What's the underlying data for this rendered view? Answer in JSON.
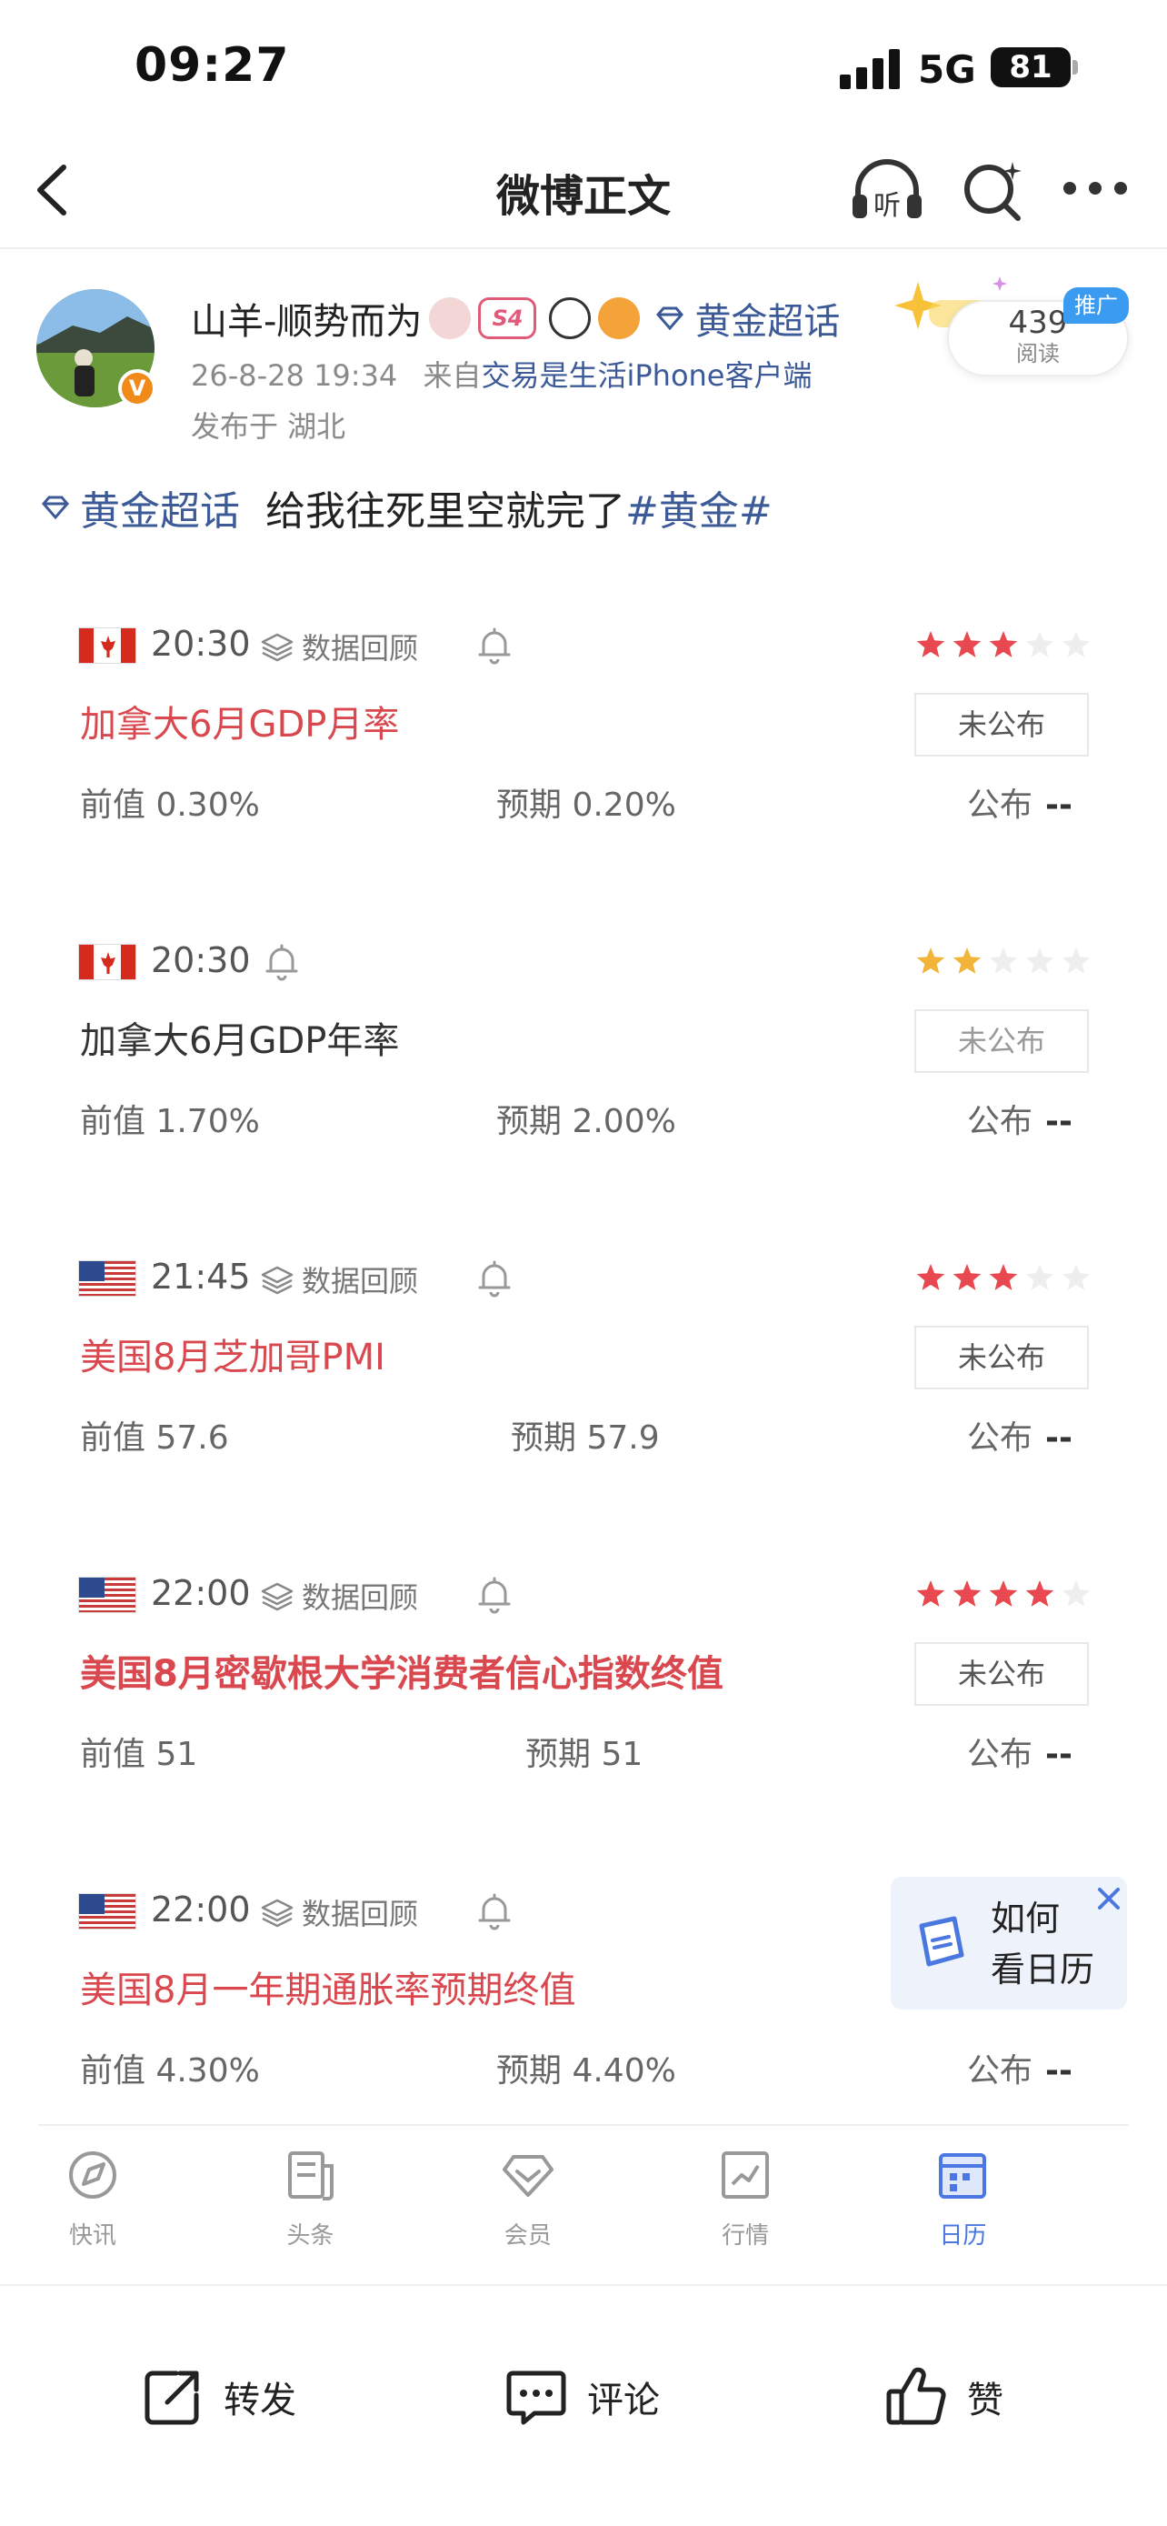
{
  "status_bar": {
    "time": "09:27",
    "network": "5G",
    "battery": "81"
  },
  "nav": {
    "title": "微博正文",
    "listen_label": "听"
  },
  "post": {
    "username": "山羊-顺势而为",
    "badge_s": "S4",
    "verified_mark": "V",
    "topic_tag": "黄金超话",
    "timestamp": "26-8-28 19:34",
    "source_prefix": "来自",
    "source": "交易是生活iPhone客户端",
    "location": "发布于 湖北",
    "reads_count": "439",
    "reads_label": "阅读",
    "promo_label": "推广",
    "text_topic": "黄金超话",
    "text_body": "给我往死里空就完了",
    "text_hashtag": "#黄金#"
  },
  "events": [
    {
      "flag": "canada",
      "time": "20:30",
      "review": "数据回顾",
      "has_review": true,
      "stars": 3,
      "star_color": "#e8484f",
      "name": "加拿大6月GDP月率",
      "name_color": "red",
      "status": "未公布",
      "prev": "前值 0.30%",
      "expected": "预期 0.20%",
      "published_label": "公布",
      "published_value": "--"
    },
    {
      "flag": "canada",
      "time": "20:30",
      "review": "",
      "has_review": false,
      "stars": 2,
      "star_color": "#f2b53a",
      "name": "加拿大6月GDP年率",
      "name_color": "black",
      "status": "未公布",
      "prev": "前值 1.70%",
      "expected": "预期 2.00%",
      "published_label": "公布",
      "published_value": "--"
    },
    {
      "flag": "usa",
      "time": "21:45",
      "review": "数据回顾",
      "has_review": true,
      "stars": 3,
      "star_color": "#e8484f",
      "name": "美国8月芝加哥PMI",
      "name_color": "red",
      "status": "未公布",
      "prev": "前值 57.6",
      "expected": "预期 57.9",
      "published_label": "公布",
      "published_value": "--"
    },
    {
      "flag": "usa",
      "time": "22:00",
      "review": "数据回顾",
      "has_review": true,
      "stars": 4,
      "star_color": "#e8484f",
      "name": "美国8月密歇根大学消费者信心指数终值",
      "name_color": "red",
      "status": "未公布",
      "prev": "前值 51",
      "expected": "预期 51",
      "published_label": "公布",
      "published_value": "--"
    },
    {
      "flag": "usa",
      "time": "22:00",
      "review": "数据回顾",
      "has_review": true,
      "stars": 0,
      "star_color": "#e8484f",
      "name": "美国8月一年期通胀率预期终值",
      "name_color": "red",
      "status": "",
      "prev": "前值 4.30%",
      "expected": "预期 4.40%",
      "published_label": "公布",
      "published_value": "--"
    }
  ],
  "helper": {
    "line1": "如何",
    "line2": "看日历"
  },
  "tabs": [
    {
      "label": "快讯",
      "icon": "compass-icon",
      "active": false
    },
    {
      "label": "头条",
      "icon": "news-icon",
      "active": false
    },
    {
      "label": "会员",
      "icon": "member-icon",
      "active": false
    },
    {
      "label": "行情",
      "icon": "chart-icon",
      "active": false
    },
    {
      "label": "日历",
      "icon": "calendar-icon",
      "active": true
    }
  ],
  "actions": {
    "repost": "转发",
    "comment": "评论",
    "like": "赞"
  },
  "colors": {
    "link": "#3d5a98",
    "event_red": "#d9484f",
    "accent_blue": "#4a78e0",
    "promo_blue": "#3b9bf0"
  }
}
